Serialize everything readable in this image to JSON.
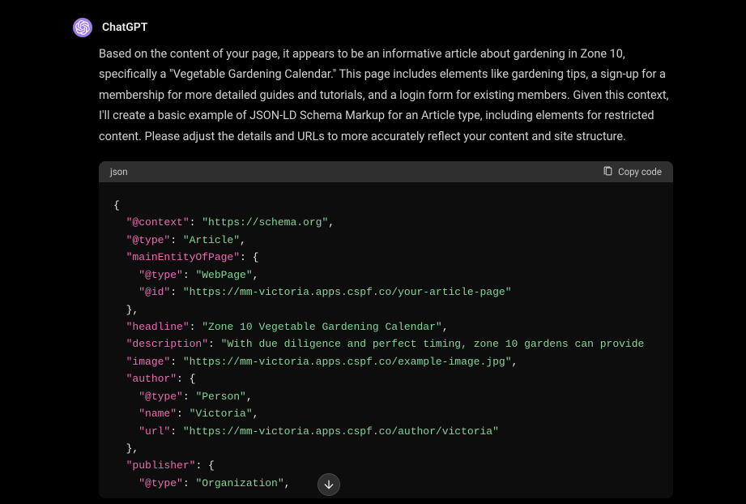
{
  "message": {
    "author": "ChatGPT",
    "body": "Based on the content of your page, it appears to be an informative article about gardening in Zone 10, specifically a \"Vegetable Gardening Calendar.\" This page includes elements like gardening tips, a sign-up for a membership for more detailed guides and tutorials, and a login form for existing members. Given this context, I'll create a basic example of JSON-LD Schema Markup for an Article type, including elements for restricted content. Please adjust the details and URLs to more accurately reflect your content and site structure."
  },
  "code": {
    "language": "json",
    "copy_label": "Copy code",
    "tokens": [
      {
        "t": "punc",
        "v": "{"
      },
      {
        "t": "nl"
      },
      {
        "t": "indent",
        "v": 1
      },
      {
        "t": "key",
        "v": "\"@context\""
      },
      {
        "t": "punc",
        "v": ": "
      },
      {
        "t": "str",
        "v": "\"https://schema.org\""
      },
      {
        "t": "punc",
        "v": ","
      },
      {
        "t": "nl"
      },
      {
        "t": "indent",
        "v": 1
      },
      {
        "t": "key",
        "v": "\"@type\""
      },
      {
        "t": "punc",
        "v": ": "
      },
      {
        "t": "str",
        "v": "\"Article\""
      },
      {
        "t": "punc",
        "v": ","
      },
      {
        "t": "nl"
      },
      {
        "t": "indent",
        "v": 1
      },
      {
        "t": "key",
        "v": "\"mainEntityOfPage\""
      },
      {
        "t": "punc",
        "v": ": {"
      },
      {
        "t": "nl"
      },
      {
        "t": "indent",
        "v": 2
      },
      {
        "t": "key",
        "v": "\"@type\""
      },
      {
        "t": "punc",
        "v": ": "
      },
      {
        "t": "str",
        "v": "\"WebPage\""
      },
      {
        "t": "punc",
        "v": ","
      },
      {
        "t": "nl"
      },
      {
        "t": "indent",
        "v": 2
      },
      {
        "t": "key",
        "v": "\"@id\""
      },
      {
        "t": "punc",
        "v": ": "
      },
      {
        "t": "str",
        "v": "\"https://mm-victoria.apps.cspf.co/your-article-page\""
      },
      {
        "t": "nl"
      },
      {
        "t": "indent",
        "v": 1
      },
      {
        "t": "punc",
        "v": "},"
      },
      {
        "t": "nl"
      },
      {
        "t": "indent",
        "v": 1
      },
      {
        "t": "key",
        "v": "\"headline\""
      },
      {
        "t": "punc",
        "v": ": "
      },
      {
        "t": "str",
        "v": "\"Zone 10 Vegetable Gardening Calendar\""
      },
      {
        "t": "punc",
        "v": ","
      },
      {
        "t": "nl"
      },
      {
        "t": "indent",
        "v": 1
      },
      {
        "t": "key",
        "v": "\"description\""
      },
      {
        "t": "punc",
        "v": ": "
      },
      {
        "t": "str",
        "v": "\"With due diligence and perfect timing, zone 10 gardens can provide"
      },
      {
        "t": "nl"
      },
      {
        "t": "indent",
        "v": 1
      },
      {
        "t": "key",
        "v": "\"image\""
      },
      {
        "t": "punc",
        "v": ": "
      },
      {
        "t": "str",
        "v": "\"https://mm-victoria.apps.cspf.co/example-image.jpg\""
      },
      {
        "t": "punc",
        "v": ","
      },
      {
        "t": "nl"
      },
      {
        "t": "indent",
        "v": 1
      },
      {
        "t": "key",
        "v": "\"author\""
      },
      {
        "t": "punc",
        "v": ": {"
      },
      {
        "t": "nl"
      },
      {
        "t": "indent",
        "v": 2
      },
      {
        "t": "key",
        "v": "\"@type\""
      },
      {
        "t": "punc",
        "v": ": "
      },
      {
        "t": "str",
        "v": "\"Person\""
      },
      {
        "t": "punc",
        "v": ","
      },
      {
        "t": "nl"
      },
      {
        "t": "indent",
        "v": 2
      },
      {
        "t": "key",
        "v": "\"name\""
      },
      {
        "t": "punc",
        "v": ": "
      },
      {
        "t": "str",
        "v": "\"Victoria\""
      },
      {
        "t": "punc",
        "v": ","
      },
      {
        "t": "nl"
      },
      {
        "t": "indent",
        "v": 2
      },
      {
        "t": "key",
        "v": "\"url\""
      },
      {
        "t": "punc",
        "v": ": "
      },
      {
        "t": "str",
        "v": "\"https://mm-victoria.apps.cspf.co/author/victoria\""
      },
      {
        "t": "nl"
      },
      {
        "t": "indent",
        "v": 1
      },
      {
        "t": "punc",
        "v": "},"
      },
      {
        "t": "nl"
      },
      {
        "t": "indent",
        "v": 1
      },
      {
        "t": "key",
        "v": "\"publisher\""
      },
      {
        "t": "punc",
        "v": ": {"
      },
      {
        "t": "nl"
      },
      {
        "t": "indent",
        "v": 2
      },
      {
        "t": "key",
        "v": "\"@type\""
      },
      {
        "t": "punc",
        "v": ": "
      },
      {
        "t": "str",
        "v": "\"Organization\""
      },
      {
        "t": "punc",
        "v": ","
      }
    ]
  }
}
